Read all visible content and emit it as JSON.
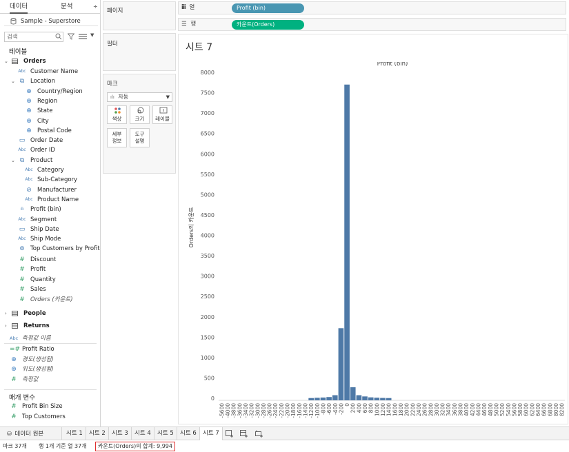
{
  "left_pane": {
    "tabs": [
      "데이터",
      "분석"
    ],
    "datasource": "Sample - Superstore",
    "search_placeholder": "검색",
    "tables_title": "테이블",
    "orders": {
      "label": "Orders",
      "items": [
        {
          "label": "Customer Name",
          "icon": "Abc",
          "indent": 1
        },
        {
          "label": "Location",
          "icon": "hierarchy-icon",
          "indent": 1,
          "caret": true
        },
        {
          "label": "Country/Region",
          "icon": "globe-icon",
          "indent": 2
        },
        {
          "label": "Region",
          "icon": "globe-icon",
          "indent": 2
        },
        {
          "label": "State",
          "icon": "globe-icon",
          "indent": 2
        },
        {
          "label": "City",
          "icon": "globe-icon",
          "indent": 2
        },
        {
          "label": "Postal Code",
          "icon": "globe-icon",
          "indent": 2
        },
        {
          "label": "Order Date",
          "icon": "calendar-icon",
          "indent": 1
        },
        {
          "label": "Order ID",
          "icon": "Abc",
          "indent": 1
        },
        {
          "label": "Product",
          "icon": "hierarchy-icon",
          "indent": 1,
          "caret": true
        },
        {
          "label": "Category",
          "icon": "Abc",
          "indent": 2
        },
        {
          "label": "Sub-Category",
          "icon": "Abc",
          "indent": 2
        },
        {
          "label": "Manufacturer",
          "icon": "link-icon",
          "indent": 2
        },
        {
          "label": "Product Name",
          "icon": "Abc",
          "indent": 2
        },
        {
          "label": "Profit (bin)",
          "icon": "bin-icon",
          "indent": 1
        },
        {
          "label": "Segment",
          "icon": "Abc",
          "indent": 1
        },
        {
          "label": "Ship Date",
          "icon": "calendar-icon",
          "indent": 1
        },
        {
          "label": "Ship Mode",
          "icon": "Abc",
          "indent": 1
        },
        {
          "label": "Top Customers by Profit",
          "icon": "set-icon",
          "indent": 1
        }
      ],
      "measures": [
        {
          "label": "Discount",
          "italic": false
        },
        {
          "label": "Profit",
          "italic": false
        },
        {
          "label": "Quantity",
          "italic": false
        },
        {
          "label": "Sales",
          "italic": false
        },
        {
          "label": "Orders (카운트)",
          "italic": true
        }
      ]
    },
    "people": "People",
    "returns": "Returns",
    "measure_names": "측정값 이름",
    "extra_measures": [
      {
        "label": "Profit Ratio",
        "icon": "calc-icon",
        "italic": false
      },
      {
        "label": "경도(생성됨)",
        "icon": "globe-icon",
        "italic": true
      },
      {
        "label": "위도(생성됨)",
        "icon": "globe-icon",
        "italic": true
      },
      {
        "label": "측정값",
        "icon": "#",
        "italic": true
      }
    ],
    "parameters_title": "매개 변수",
    "parameters": [
      "Profit Bin Size",
      "Top Customers"
    ]
  },
  "middle_pane": {
    "pages": "페이지",
    "filters": "필터",
    "marks": "마크",
    "mark_type": "자동",
    "mark_buttons": [
      {
        "label": "색상",
        "icon": "color-icon"
      },
      {
        "label": "크기",
        "icon": "size-icon"
      },
      {
        "label": "레이블",
        "icon": "label-icon"
      },
      {
        "label": "세부 정보",
        "icon": "detail-icon"
      },
      {
        "label": "도구 설명",
        "icon": "tooltip-icon"
      }
    ]
  },
  "shelves": {
    "columns_label": "열",
    "rows_label": "행",
    "columns_pill": "Profit (bin)",
    "rows_pill": "카운트(Orders)"
  },
  "sheet": {
    "title": "시트 7"
  },
  "chart_data": {
    "type": "bar",
    "title": "Profit (bin)",
    "ylabel": "Orders의 카운트",
    "xlabel": "",
    "ylim": [
      0,
      8000
    ],
    "y_ticks": [
      0,
      500,
      1000,
      1500,
      2000,
      2500,
      3000,
      3500,
      4000,
      4500,
      5000,
      5500,
      6000,
      6500,
      7000,
      7500,
      8000
    ],
    "x_ticks": [
      -5600,
      -4000,
      -3800,
      -3600,
      -3400,
      -3200,
      -3000,
      -2800,
      -2600,
      -2400,
      -2200,
      -2000,
      -1800,
      -1600,
      -1400,
      -1200,
      -1000,
      -800,
      -600,
      -400,
      -200,
      0,
      200,
      400,
      600,
      800,
      1000,
      1200,
      1400,
      1600,
      1800,
      2000,
      2200,
      2400,
      2600,
      2800,
      3000,
      3200,
      3400,
      3600,
      3800,
      4000,
      4200,
      4400,
      4600,
      4800,
      5000,
      5200,
      5400,
      5600,
      5800,
      6000,
      6200,
      6400,
      6600,
      6800,
      8000,
      8200
    ],
    "bars": [
      {
        "bin": -1200,
        "count": 5
      },
      {
        "bin": -1000,
        "count": 12
      },
      {
        "bin": -800,
        "count": 18
      },
      {
        "bin": -600,
        "count": 30
      },
      {
        "bin": -400,
        "count": 75
      },
      {
        "bin": -200,
        "count": 1720
      },
      {
        "bin": 0,
        "count": 7700
      },
      {
        "bin": 200,
        "count": 270
      },
      {
        "bin": 400,
        "count": 75
      },
      {
        "bin": 600,
        "count": 45
      },
      {
        "bin": 800,
        "count": 22
      },
      {
        "bin": 1000,
        "count": 14
      },
      {
        "bin": 1200,
        "count": 8
      },
      {
        "bin": 1400,
        "count": 5
      }
    ],
    "bar_color": "#4e79a7",
    "grid": false
  },
  "tabs": {
    "datasource": "데이터 원본",
    "sheets": [
      "시트 1",
      "시트 2",
      "시트 3",
      "시트 4",
      "시트 5",
      "시트 6",
      "시트 7"
    ],
    "active": "시트 7"
  },
  "status": {
    "marks": "마크 37개",
    "rows_cols": "행 1개 기준 열 37개",
    "sum": "카운트(Orders)의 합계: 9,994"
  },
  "colors": {
    "columns_pill": "#4996b2",
    "rows_pill": "#00b180",
    "accent_red": "#e03030"
  }
}
